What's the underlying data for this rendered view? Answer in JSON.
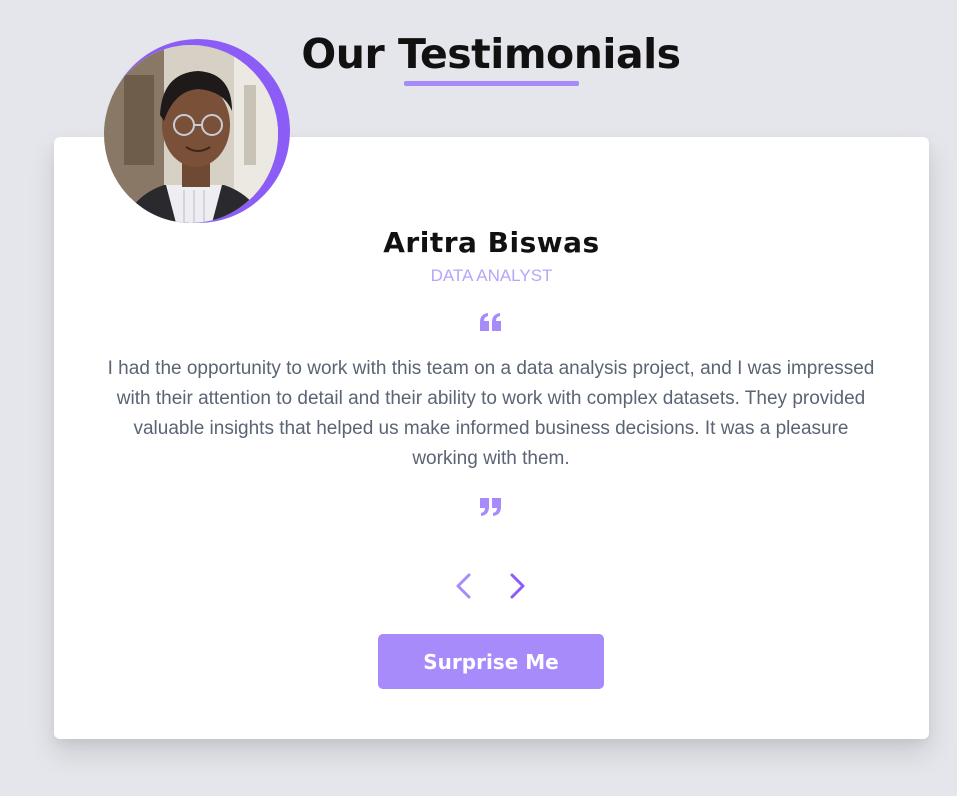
{
  "header": {
    "title": "Our Testimonials"
  },
  "testimonial": {
    "name": "Aritra Biswas",
    "job": "Data Analyst",
    "text": "I had the opportunity to work with this team on a data analysis project, and I was impressed with their attention to detail and their ability to work with complex datasets. They provided valuable insights that helped us make informed business decisions. It was a pleasure working with them.",
    "avatar_alt": "Aritra Biswas"
  },
  "controls": {
    "prev_icon": "chevron-left-icon",
    "next_icon": "chevron-right-icon",
    "surprise_label": "Surprise Me"
  },
  "colors": {
    "accent": "#a78bfa",
    "accent_dark": "#8b5cf6",
    "text_muted": "#5b6474",
    "background": "#e5e6eb",
    "card": "#ffffff"
  }
}
